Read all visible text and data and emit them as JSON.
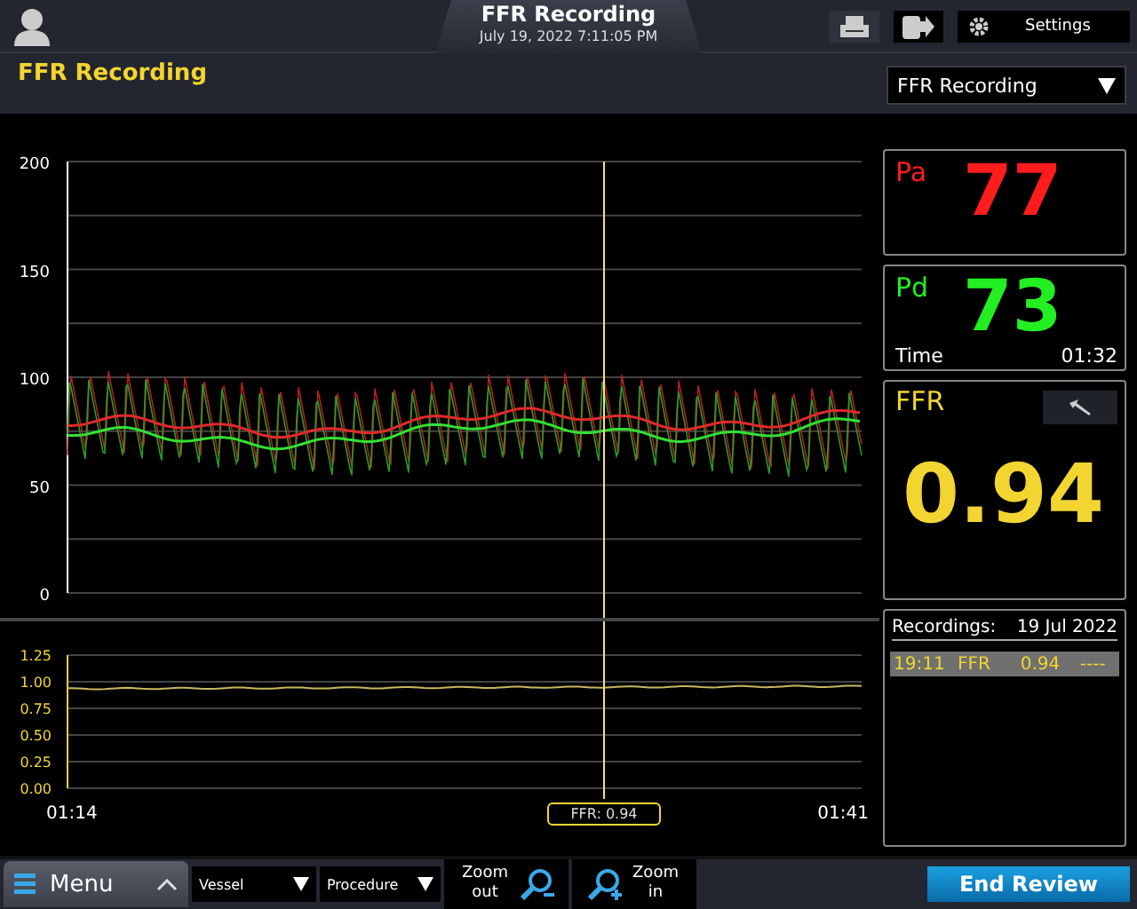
{
  "header": {
    "title": "FFR Recording",
    "datetime": "July 19, 2022 7:11:05 PM",
    "settings_label": "Settings"
  },
  "page_title": "FFR Recording",
  "mode_select": {
    "value": "FFR Recording"
  },
  "pressure_chart": {
    "y_ticks": [
      "200",
      "150",
      "100",
      "50",
      "0"
    ]
  },
  "ffr_chart": {
    "y_ticks": [
      "1.25",
      "1.00",
      "0.75",
      "0.50",
      "0.25",
      "0.00"
    ]
  },
  "time_axis": {
    "start": "01:14",
    "end": "01:41"
  },
  "cursor": {
    "label": "FFR: 0.94"
  },
  "readouts": [
    {
      "label": "Pa",
      "value": "77",
      "color": "#ff1c1c"
    },
    {
      "label": "Pd",
      "value": "73",
      "color": "#22ee22",
      "time_label": "Time",
      "time": "01:32"
    }
  ],
  "ffr": {
    "label": "FFR",
    "value": "0.94"
  },
  "recordings": {
    "title": "Recordings:",
    "date": "19 Jul 2022",
    "items": [
      {
        "time": "19:11",
        "type": "FFR",
        "value": "0.94",
        "extra": "----",
        "selected": true
      }
    ]
  },
  "toolbar": {
    "menu_label": "Menu",
    "vessel": "Vessel",
    "procedure": "Procedure",
    "zoom_out": "Zoom out",
    "zoom_in": "Zoom in",
    "end_review": "End Review"
  }
}
